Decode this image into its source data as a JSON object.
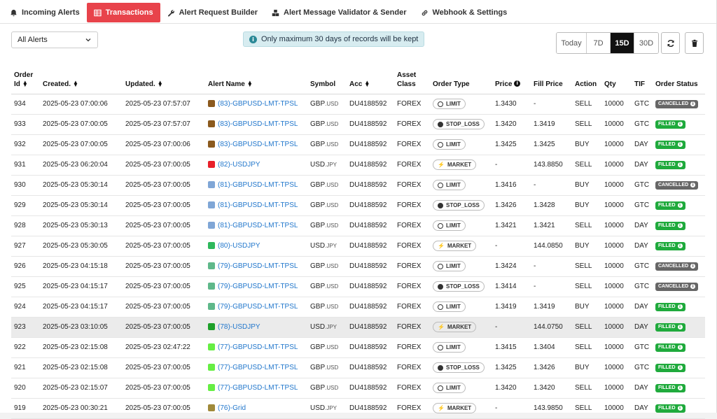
{
  "tabs": [
    {
      "label": "Incoming Alerts",
      "icon": "bell-icon",
      "active": false
    },
    {
      "label": "Transactions",
      "icon": "table-icon",
      "active": true
    },
    {
      "label": "Alert Request Builder",
      "icon": "wrench-icon",
      "active": false
    },
    {
      "label": "Alert Message Validator & Sender",
      "icon": "boxes-icon",
      "active": false
    },
    {
      "label": "Webhook & Settings",
      "icon": "link-icon",
      "active": false
    }
  ],
  "filter": {
    "selected": "All Alerts"
  },
  "notice": {
    "text": "Only maximum 30 days of records will be kept"
  },
  "ranges": [
    {
      "label": "Today",
      "active": false
    },
    {
      "label": "7D",
      "active": false
    },
    {
      "label": "15D",
      "active": true
    },
    {
      "label": "30D",
      "active": false
    }
  ],
  "columns": {
    "order_id": "Order Id",
    "created": "Created.",
    "updated": "Updated.",
    "alert_name": "Alert Name",
    "symbol": "Symbol",
    "acc": "Acc",
    "asset_class": "Asset Class",
    "order_type": "Order Type",
    "price": "Price",
    "fill_price": "Fill Price",
    "action": "Action",
    "qty": "Qty",
    "tif": "TIF",
    "order_status": "Order Status"
  },
  "rows": [
    {
      "id": "934",
      "created": "2025-05-23 07:00:06",
      "updated": "2025-05-23 07:57:07",
      "color": "#8b5a1e",
      "alert": "(83)-GBPUSD-LMT-TPSL",
      "sym_base": "GBP",
      "sym_quote": ".USD",
      "acc": "DU4188592",
      "asset": "FOREX",
      "otype": "LIMIT",
      "price": "1.3430",
      "fill": "-",
      "action": "SELL",
      "qty": "10000",
      "tif": "GTC",
      "status": "CANCELLED"
    },
    {
      "id": "933",
      "created": "2025-05-23 07:00:05",
      "updated": "2025-05-23 07:57:07",
      "color": "#8b5a1e",
      "alert": "(83)-GBPUSD-LMT-TPSL",
      "sym_base": "GBP",
      "sym_quote": ".USD",
      "acc": "DU4188592",
      "asset": "FOREX",
      "otype": "STOP_LOSS",
      "price": "1.3420",
      "fill": "1.3419",
      "action": "SELL",
      "qty": "10000",
      "tif": "GTC",
      "status": "FILLED"
    },
    {
      "id": "932",
      "created": "2025-05-23 07:00:05",
      "updated": "2025-05-23 07:00:06",
      "color": "#8b5a1e",
      "alert": "(83)-GBPUSD-LMT-TPSL",
      "sym_base": "GBP",
      "sym_quote": ".USD",
      "acc": "DU4188592",
      "asset": "FOREX",
      "otype": "LIMIT",
      "price": "1.3425",
      "fill": "1.3425",
      "action": "BUY",
      "qty": "10000",
      "tif": "DAY",
      "status": "FILLED"
    },
    {
      "id": "931",
      "created": "2025-05-23 06:20:04",
      "updated": "2025-05-23 07:00:05",
      "color": "#e8202a",
      "alert": "(82)-USDJPY",
      "sym_base": "USD",
      "sym_quote": ".JPY",
      "acc": "DU4188592",
      "asset": "FOREX",
      "otype": "MARKET",
      "price": "-",
      "fill": "143.8850",
      "action": "SELL",
      "qty": "10000",
      "tif": "DAY",
      "status": "FILLED"
    },
    {
      "id": "930",
      "created": "2025-05-23 05:30:14",
      "updated": "2025-05-23 07:00:05",
      "color": "#7fa6d6",
      "alert": "(81)-GBPUSD-LMT-TPSL",
      "sym_base": "GBP",
      "sym_quote": ".USD",
      "acc": "DU4188592",
      "asset": "FOREX",
      "otype": "LIMIT",
      "price": "1.3416",
      "fill": "-",
      "action": "BUY",
      "qty": "10000",
      "tif": "GTC",
      "status": "CANCELLED"
    },
    {
      "id": "929",
      "created": "2025-05-23 05:30:14",
      "updated": "2025-05-23 07:00:05",
      "color": "#7fa6d6",
      "alert": "(81)-GBPUSD-LMT-TPSL",
      "sym_base": "GBP",
      "sym_quote": ".USD",
      "acc": "DU4188592",
      "asset": "FOREX",
      "otype": "STOP_LOSS",
      "price": "1.3426",
      "fill": "1.3428",
      "action": "BUY",
      "qty": "10000",
      "tif": "GTC",
      "status": "FILLED"
    },
    {
      "id": "928",
      "created": "2025-05-23 05:30:13",
      "updated": "2025-05-23 07:00:05",
      "color": "#7fa6d6",
      "alert": "(81)-GBPUSD-LMT-TPSL",
      "sym_base": "GBP",
      "sym_quote": ".USD",
      "acc": "DU4188592",
      "asset": "FOREX",
      "otype": "LIMIT",
      "price": "1.3421",
      "fill": "1.3421",
      "action": "SELL",
      "qty": "10000",
      "tif": "DAY",
      "status": "FILLED"
    },
    {
      "id": "927",
      "created": "2025-05-23 05:30:05",
      "updated": "2025-05-23 07:00:05",
      "color": "#2eb85c",
      "alert": "(80)-USDJPY",
      "sym_base": "USD",
      "sym_quote": ".JPY",
      "acc": "DU4188592",
      "asset": "FOREX",
      "otype": "MARKET",
      "price": "-",
      "fill": "144.0850",
      "action": "BUY",
      "qty": "10000",
      "tif": "DAY",
      "status": "FILLED"
    },
    {
      "id": "926",
      "created": "2025-05-23 04:15:18",
      "updated": "2025-05-23 07:00:05",
      "color": "#5fb88a",
      "alert": "(79)-GBPUSD-LMT-TPSL",
      "sym_base": "GBP",
      "sym_quote": ".USD",
      "acc": "DU4188592",
      "asset": "FOREX",
      "otype": "LIMIT",
      "price": "1.3424",
      "fill": "-",
      "action": "SELL",
      "qty": "10000",
      "tif": "GTC",
      "status": "CANCELLED"
    },
    {
      "id": "925",
      "created": "2025-05-23 04:15:17",
      "updated": "2025-05-23 07:00:05",
      "color": "#5fb88a",
      "alert": "(79)-GBPUSD-LMT-TPSL",
      "sym_base": "GBP",
      "sym_quote": ".USD",
      "acc": "DU4188592",
      "asset": "FOREX",
      "otype": "STOP_LOSS",
      "price": "1.3414",
      "fill": "-",
      "action": "SELL",
      "qty": "10000",
      "tif": "GTC",
      "status": "CANCELLED"
    },
    {
      "id": "924",
      "created": "2025-05-23 04:15:17",
      "updated": "2025-05-23 07:00:05",
      "color": "#5fb88a",
      "alert": "(79)-GBPUSD-LMT-TPSL",
      "sym_base": "GBP",
      "sym_quote": ".USD",
      "acc": "DU4188592",
      "asset": "FOREX",
      "otype": "LIMIT",
      "price": "1.3419",
      "fill": "1.3419",
      "action": "BUY",
      "qty": "10000",
      "tif": "DAY",
      "status": "FILLED"
    },
    {
      "id": "923",
      "created": "2025-05-23 03:10:05",
      "updated": "2025-05-23 07:00:05",
      "color": "#1ea02a",
      "alert": "(78)-USDJPY",
      "sym_base": "USD",
      "sym_quote": ".JPY",
      "acc": "DU4188592",
      "asset": "FOREX",
      "otype": "MARKET",
      "price": "-",
      "fill": "144.0750",
      "action": "SELL",
      "qty": "10000",
      "tif": "DAY",
      "status": "FILLED",
      "highlight": true
    },
    {
      "id": "922",
      "created": "2025-05-23 02:15:08",
      "updated": "2025-05-23 02:47:22",
      "color": "#66ee44",
      "alert": "(77)-GBPUSD-LMT-TPSL",
      "sym_base": "GBP",
      "sym_quote": ".USD",
      "acc": "DU4188592",
      "asset": "FOREX",
      "otype": "LIMIT",
      "price": "1.3415",
      "fill": "1.3404",
      "action": "SELL",
      "qty": "10000",
      "tif": "GTC",
      "status": "FILLED"
    },
    {
      "id": "921",
      "created": "2025-05-23 02:15:08",
      "updated": "2025-05-23 07:00:05",
      "color": "#66ee44",
      "alert": "(77)-GBPUSD-LMT-TPSL",
      "sym_base": "GBP",
      "sym_quote": ".USD",
      "acc": "DU4188592",
      "asset": "FOREX",
      "otype": "STOP_LOSS",
      "price": "1.3425",
      "fill": "1.3426",
      "action": "BUY",
      "qty": "10000",
      "tif": "GTC",
      "status": "FILLED"
    },
    {
      "id": "920",
      "created": "2025-05-23 02:15:07",
      "updated": "2025-05-23 07:00:05",
      "color": "#66ee44",
      "alert": "(77)-GBPUSD-LMT-TPSL",
      "sym_base": "GBP",
      "sym_quote": ".USD",
      "acc": "DU4188592",
      "asset": "FOREX",
      "otype": "LIMIT",
      "price": "1.3420",
      "fill": "1.3420",
      "action": "SELL",
      "qty": "10000",
      "tif": "DAY",
      "status": "FILLED"
    },
    {
      "id": "919",
      "created": "2025-05-23 00:30:21",
      "updated": "2025-05-23 07:00:05",
      "color": "#a08a3a",
      "alert": "(76)-Grid",
      "sym_base": "USD",
      "sym_quote": ".JPY",
      "acc": "DU4188592",
      "asset": "FOREX",
      "otype": "MARKET",
      "price": "-",
      "fill": "143.9850",
      "action": "SELL",
      "qty": "10000",
      "tif": "DAY",
      "status": "FILLED"
    }
  ]
}
